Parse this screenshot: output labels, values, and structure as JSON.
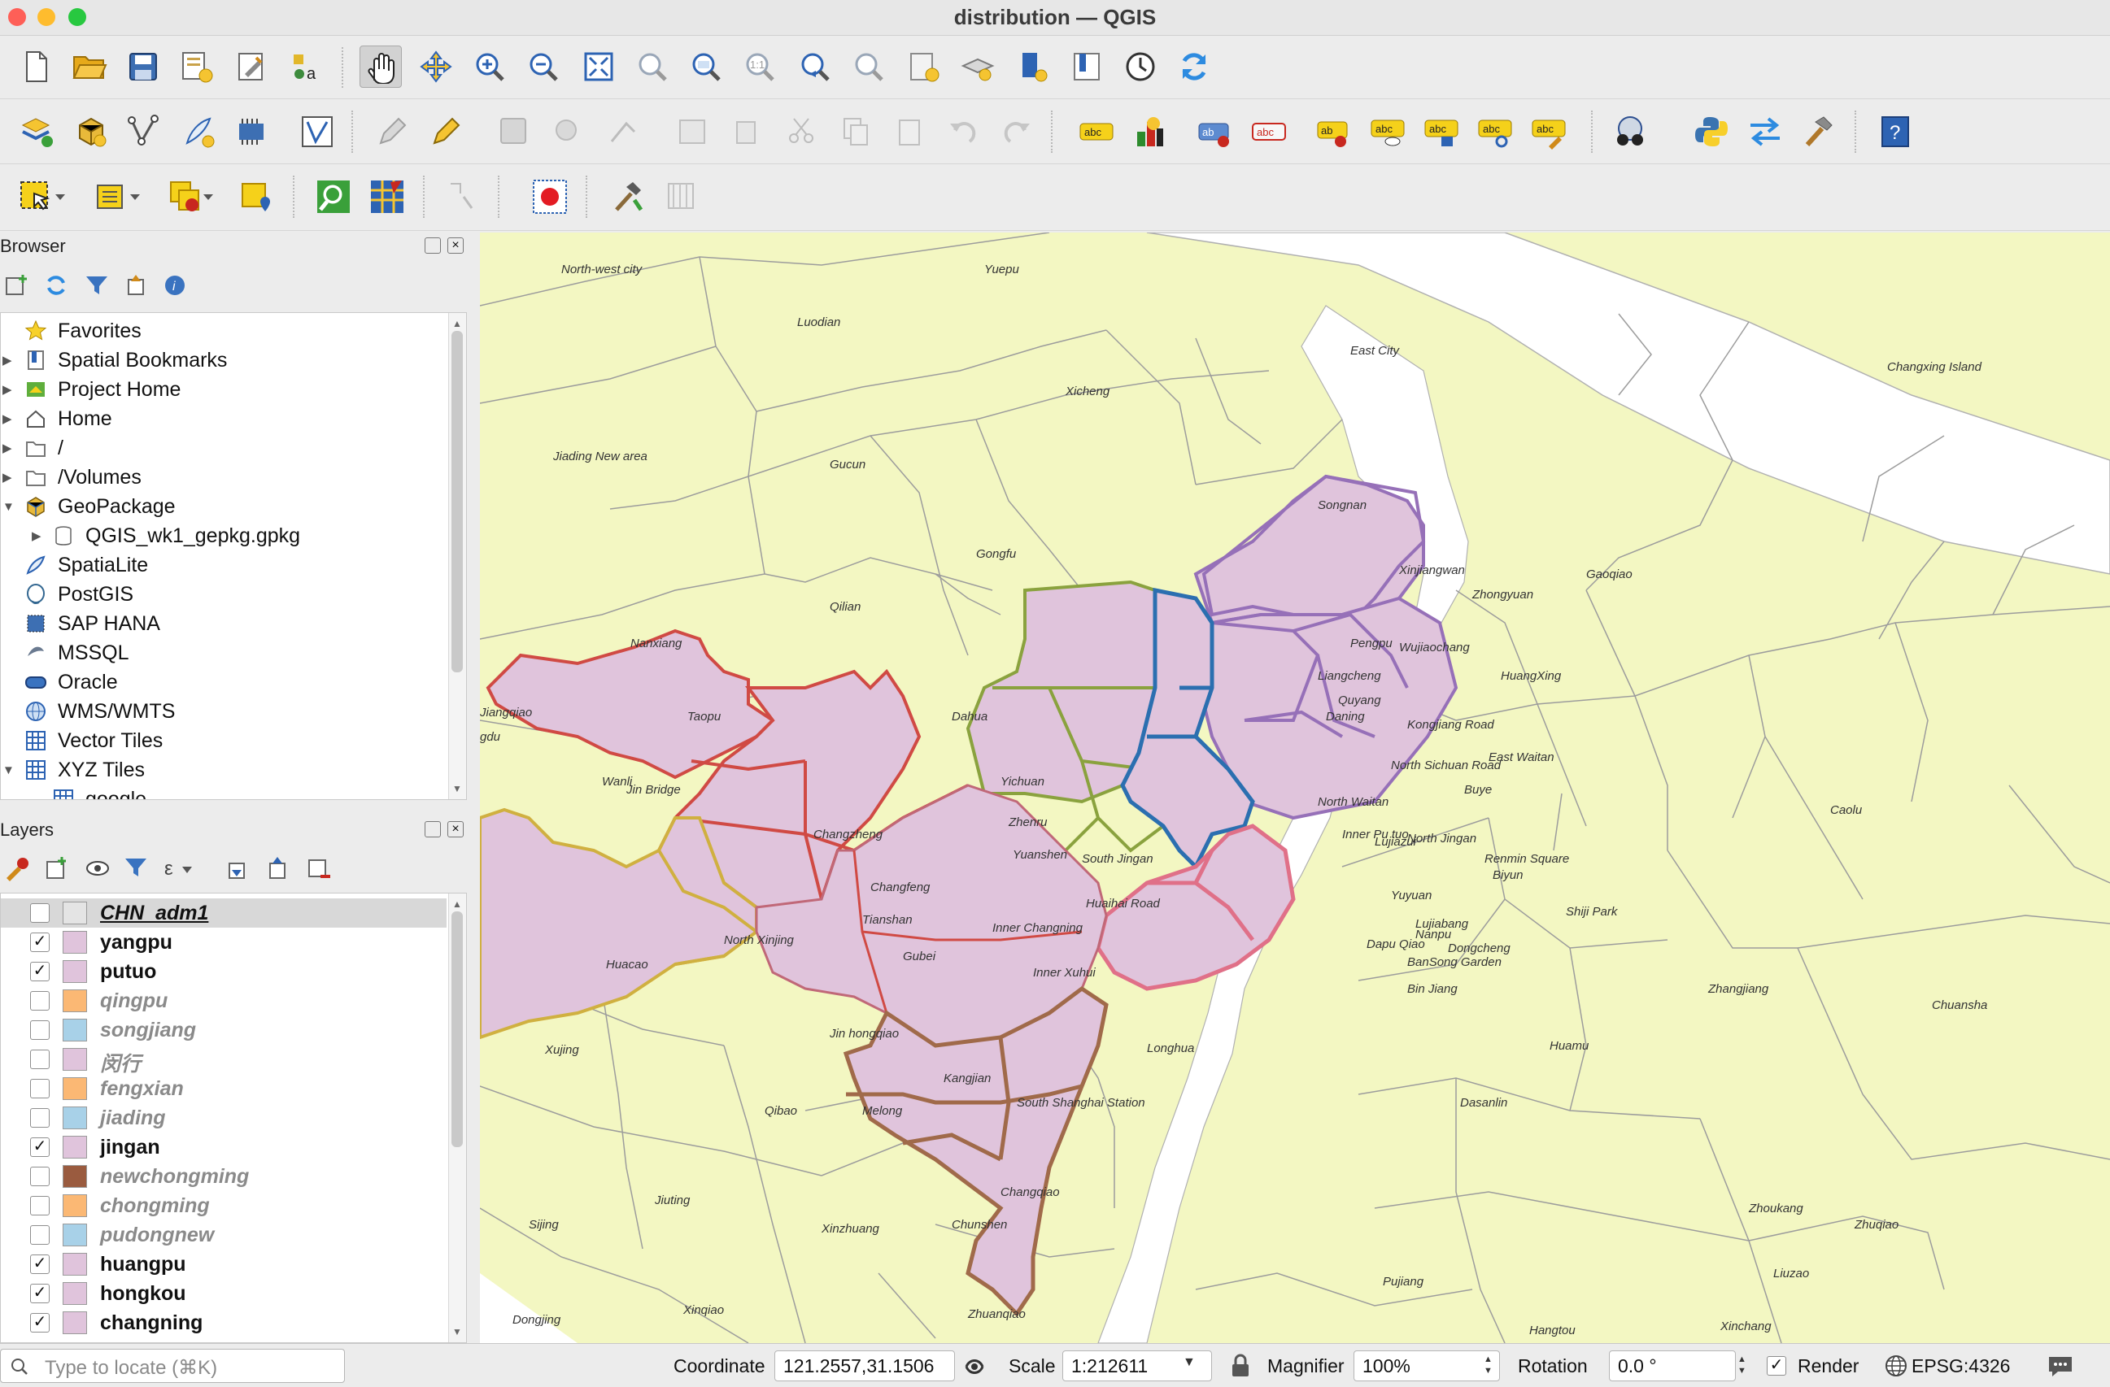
{
  "window": {
    "title": "distribution — QGIS"
  },
  "browser": {
    "title": "Browser",
    "items": [
      {
        "label": "Favorites",
        "icon": "star-icon",
        "expand": false
      },
      {
        "label": "Spatial Bookmarks",
        "icon": "bookmark-icon",
        "expand": true
      },
      {
        "label": "Project Home",
        "icon": "project-home-icon",
        "expand": true
      },
      {
        "label": "Home",
        "icon": "home-icon",
        "expand": true
      },
      {
        "label": "/",
        "icon": "folder-icon",
        "expand": true
      },
      {
        "label": "/Volumes",
        "icon": "folder-icon",
        "expand": true
      },
      {
        "label": "GeoPackage",
        "icon": "geopackage-icon",
        "expand": "open"
      },
      {
        "label": "QGIS_wk1_gepkg.gpkg",
        "icon": "database-icon",
        "expand": true,
        "child": true
      },
      {
        "label": "SpatiaLite",
        "icon": "spatialite-icon",
        "expand": false
      },
      {
        "label": "PostGIS",
        "icon": "postgis-icon",
        "expand": false
      },
      {
        "label": "SAP HANA",
        "icon": "sap-hana-icon",
        "expand": false
      },
      {
        "label": "MSSQL",
        "icon": "mssql-icon",
        "expand": false
      },
      {
        "label": "Oracle",
        "icon": "oracle-icon",
        "expand": false
      },
      {
        "label": "WMS/WMTS",
        "icon": "globe-icon",
        "expand": false
      },
      {
        "label": "Vector Tiles",
        "icon": "grid-icon",
        "expand": false
      },
      {
        "label": "XYZ Tiles",
        "icon": "grid-icon",
        "expand": "open"
      },
      {
        "label": "google",
        "icon": "grid-icon",
        "expand": false,
        "child": true
      }
    ]
  },
  "layers": {
    "title": "Layers",
    "items": [
      {
        "name": "CHN_adm1",
        "checked": false,
        "color": "#e4e4e4",
        "selected": true
      },
      {
        "name": "yangpu",
        "checked": true,
        "color": "#e0c4dc"
      },
      {
        "name": "putuo",
        "checked": true,
        "color": "#e0c4dc"
      },
      {
        "name": "qingpu",
        "checked": false,
        "color": "#fbb874"
      },
      {
        "name": "songjiang",
        "checked": false,
        "color": "#a8d1e8"
      },
      {
        "name": "闵行",
        "checked": false,
        "color": "#e0c4dc"
      },
      {
        "name": "fengxian",
        "checked": false,
        "color": "#fbb874"
      },
      {
        "name": "jiading",
        "checked": false,
        "color": "#a8d1e8"
      },
      {
        "name": "jingan",
        "checked": true,
        "color": "#e0c4dc"
      },
      {
        "name": "newchongming",
        "checked": false,
        "color": "#9a5b3f"
      },
      {
        "name": "chongming",
        "checked": false,
        "color": "#fbb874"
      },
      {
        "name": "pudongnew",
        "checked": false,
        "color": "#a8d1e8"
      },
      {
        "name": "huangpu",
        "checked": true,
        "color": "#e0c4dc"
      },
      {
        "name": "hongkou",
        "checked": true,
        "color": "#e0c4dc"
      },
      {
        "name": "changning",
        "checked": true,
        "color": "#e0c4dc"
      }
    ]
  },
  "map": {
    "labels": [
      "North-west city",
      "Yuepu",
      "Luodian",
      "East City",
      "Xicheng",
      "Changxing Island",
      "Jiading New area",
      "Gucun",
      "Songnan",
      "Gongfu",
      "Xinjiangwan",
      "Zhongyuan",
      "Gaoqiao",
      "Qilian",
      "Pengpu",
      "Wujiaochang",
      "Nanxiang",
      "Liangcheng",
      "HuangXing",
      "Taopu",
      "Quyang",
      "Dahua",
      "Daning",
      "Kongjiang Road",
      "East Waitan",
      "Wanli",
      "Yichuan",
      "North Sichuan Road",
      "Jiangqiao",
      "Jin Bridge",
      "Buye",
      "North Waitan",
      "Caolu",
      "Zhenru",
      "Changzheng",
      "Inner Pu tuo",
      "North Jingan",
      "Renmin Square",
      "Lujiazui",
      "Yuanshen",
      "Changfeng",
      "South Jingan",
      "Yuyuan",
      "Biyun",
      "Tianshan",
      "Huaihai Road",
      "Inner Changning",
      "Lujiabang",
      "Nanpu",
      "Shiji Park",
      "North Xinjing",
      "Gubei",
      "Dapu Qiao",
      "Dongcheng",
      "BanSong Garden",
      "Huacao",
      "Inner Xuhui",
      "Bin Jiang",
      "Zhangjiang",
      "Chuansha",
      "Jin hongqiao",
      "Xujing",
      "Longhua",
      "Huamu",
      "Kangjian",
      "South Shanghai Station",
      "Qibao",
      "Melong",
      "Dasanlin",
      "Jiuting",
      "Changqiao",
      "Zhoukang",
      "Sijing",
      "Xinzhuang",
      "Chunshen",
      "Zhuqiao",
      "Pujiang",
      "Liuzao",
      "Dongjing",
      "Xinqiao",
      "Zhuanqiao",
      "Hangtou",
      "Xinchang",
      "gdu"
    ]
  },
  "status": {
    "locate_placeholder": "Type to locate (⌘K)",
    "coordinate_label": "Coordinate",
    "coordinate_value": "121.2557,31.1506",
    "scale_label": "Scale",
    "scale_value": "1:212611",
    "magnifier_label": "Magnifier",
    "magnifier_value": "100%",
    "rotation_label": "Rotation",
    "rotation_value": "0.0 °",
    "render_label": "Render",
    "crs_label": "EPSG:4326"
  }
}
